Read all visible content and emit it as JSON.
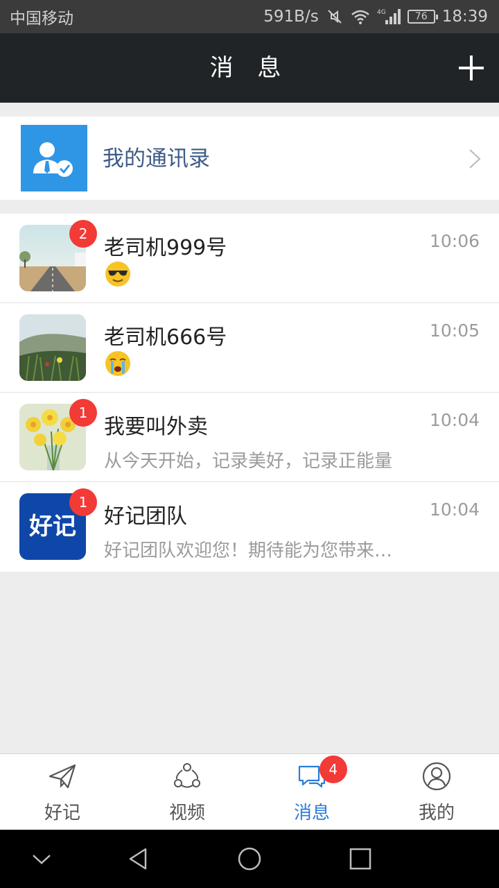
{
  "status_bar": {
    "carrier": "中国移动",
    "net_speed": "591B/s",
    "network_type": "4G",
    "battery": "76",
    "time": "18:39"
  },
  "header": {
    "title": "消 息",
    "add_icon": "plus-icon"
  },
  "contacts": {
    "label": "我的通讯录",
    "icon": "contacts-verified-icon"
  },
  "conversations": [
    {
      "name": "老司机999号",
      "time": "10:06",
      "badge": "2",
      "preview": "",
      "emoji": "sunglasses-face",
      "avatar": "road-landscape"
    },
    {
      "name": "老司机666号",
      "time": "10:05",
      "badge": "",
      "preview": "",
      "emoji": "crying-face",
      "avatar": "grass-field"
    },
    {
      "name": "我要叫外卖",
      "time": "10:04",
      "badge": "1",
      "preview": "从今天开始，记录美好，记录正能量",
      "avatar": "daffodils"
    },
    {
      "name": "好记团队",
      "time": "10:04",
      "badge": "1",
      "preview": "好记团队欢迎您！期待能为您带来…",
      "avatar": "haoji-logo",
      "avatar_text": "好记"
    }
  ],
  "tabs": [
    {
      "label": "好记",
      "icon": "paper-plane-icon",
      "active": false
    },
    {
      "label": "视频",
      "icon": "share-circles-icon",
      "active": false
    },
    {
      "label": "消息",
      "icon": "chat-bubbles-icon",
      "active": true,
      "badge": "4"
    },
    {
      "label": "我的",
      "icon": "user-circle-icon",
      "active": false
    }
  ],
  "colors": {
    "header_bg": "#202427",
    "accent": "#2a7cd9",
    "badge": "#f23a36",
    "contacts_icon_bg": "#2f96e6",
    "logo_bg": "#0f47a8"
  }
}
